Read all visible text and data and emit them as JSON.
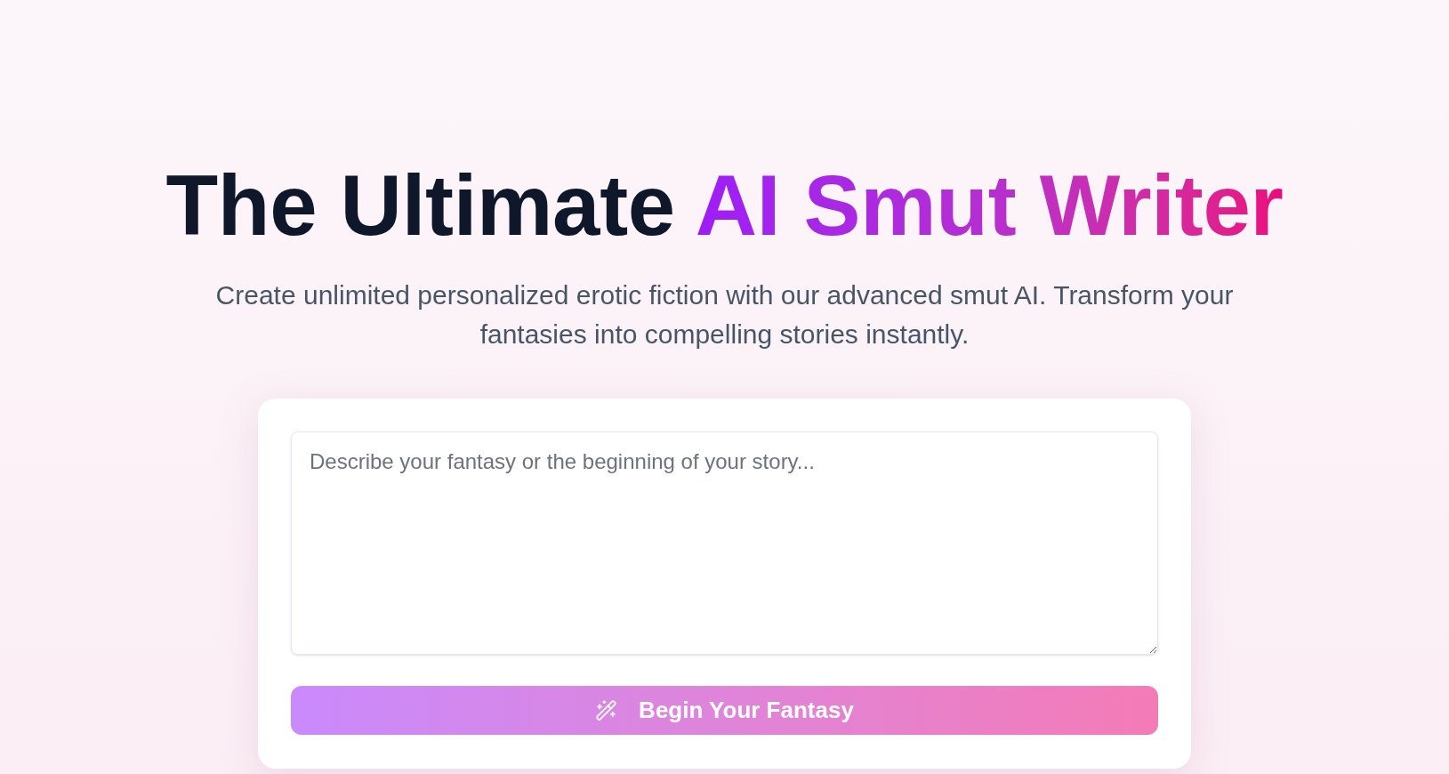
{
  "hero": {
    "title": [
      {
        "text": "The Ultimate",
        "kind": "plain"
      },
      {
        "text": "AI Smut Writer",
        "kind": "gradient"
      }
    ],
    "subtitle": "Create unlimited personalized erotic fiction with our advanced smut AI. Transform your fantasies into compelling stories instantly."
  },
  "story_form": {
    "prompt_field": {
      "placeholder": "Describe your fantasy or the beginning of your story..."
    },
    "submit_button": {
      "label": "Begin Your Fantasy"
    }
  }
}
